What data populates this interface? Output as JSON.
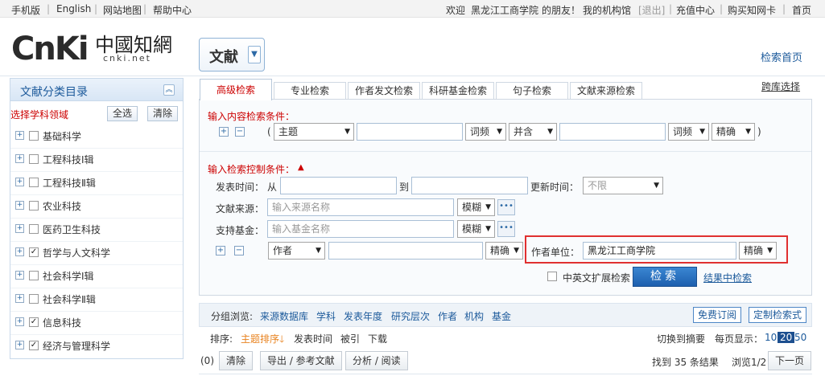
{
  "topbar": {
    "left_links": [
      "手机版",
      "English",
      "网站地图",
      "帮助中心"
    ],
    "welcome_prefix": "欢迎",
    "institution": "黑龙江工商学院",
    "welcome_suffix": "的朋友！",
    "my_library": "我的机构馆",
    "logout": "[退出]",
    "recharge": "充值中心",
    "buy_card": "购买知网卡",
    "home": "首页"
  },
  "logo": {
    "latin": "CnKi",
    "chinese": "中國知網",
    "domain": "cnki.net"
  },
  "doc_type": {
    "label": "文献"
  },
  "header": {
    "search_home": "检索首页"
  },
  "sidebar": {
    "title": "文献分类目录",
    "select_label": "选择学科领域",
    "select_all": "全选",
    "clear": "清除",
    "items": [
      {
        "label": "基础科学",
        "checked": false
      },
      {
        "label": "工程科技Ⅰ辑",
        "checked": false
      },
      {
        "label": "工程科技Ⅱ辑",
        "checked": false
      },
      {
        "label": "农业科技",
        "checked": false
      },
      {
        "label": "医药卫生科技",
        "checked": false
      },
      {
        "label": "哲学与人文科学",
        "checked": true
      },
      {
        "label": "社会科学Ⅰ辑",
        "checked": false
      },
      {
        "label": "社会科学Ⅱ辑",
        "checked": false
      },
      {
        "label": "信息科技",
        "checked": true
      },
      {
        "label": "经济与管理科学",
        "checked": true
      }
    ]
  },
  "tabs": [
    "高级检索",
    "专业检索",
    "作者发文检索",
    "科研基金检索",
    "句子检索",
    "文献来源检索"
  ],
  "range_select": "跨库选择",
  "content_conditions": {
    "title": "输入内容检索条件：",
    "field": "主题",
    "freq1": "词频",
    "logic": "并含",
    "freq2": "词频",
    "match": "精确",
    "open_paren": "(",
    "close_paren": ")"
  },
  "control_conditions": {
    "title": "输入检索控制条件：",
    "publish_time": "发表时间：",
    "from": "从",
    "to": "到",
    "update_time": "更新时间：",
    "update_value": "不限",
    "source_label": "文献来源：",
    "source_placeholder": "输入来源名称",
    "source_match": "模糊",
    "fund_label": "支持基金：",
    "fund_placeholder": "输入基金名称",
    "fund_match": "模糊",
    "author_field": "作者",
    "author_match": "精确",
    "unit_label": "作者单位：",
    "unit_value": "黑龙江工商学院",
    "unit_match": "精确",
    "cross_lang": "中英文扩展检索",
    "search_btn": "检索",
    "in_result": "结果中检索"
  },
  "results": {
    "group_label": "分组浏览:",
    "groups": [
      "来源数据库",
      "学科",
      "发表年度",
      "研究层次",
      "作者",
      "机构",
      "基金"
    ],
    "free_subscribe": "免费订阅",
    "custom_query": "定制检索式",
    "sort_label": "排序:",
    "sort_topic": "主题排序",
    "sort_time": "发表时间",
    "sort_cited": "被引",
    "sort_download": "下载",
    "switch_abstract": "切换到摘要",
    "per_page_label": "每页显示：",
    "per_page": [
      "10",
      "20",
      "50"
    ],
    "per_page_selected": "20",
    "selected_count": "(0)",
    "clear_btn": "清除",
    "export_btn": "导出 / 参考文献",
    "analyze_btn": "分析 / 阅读",
    "found": "找到 35 条结果",
    "browse": "浏览1/2",
    "next": "下一页"
  }
}
